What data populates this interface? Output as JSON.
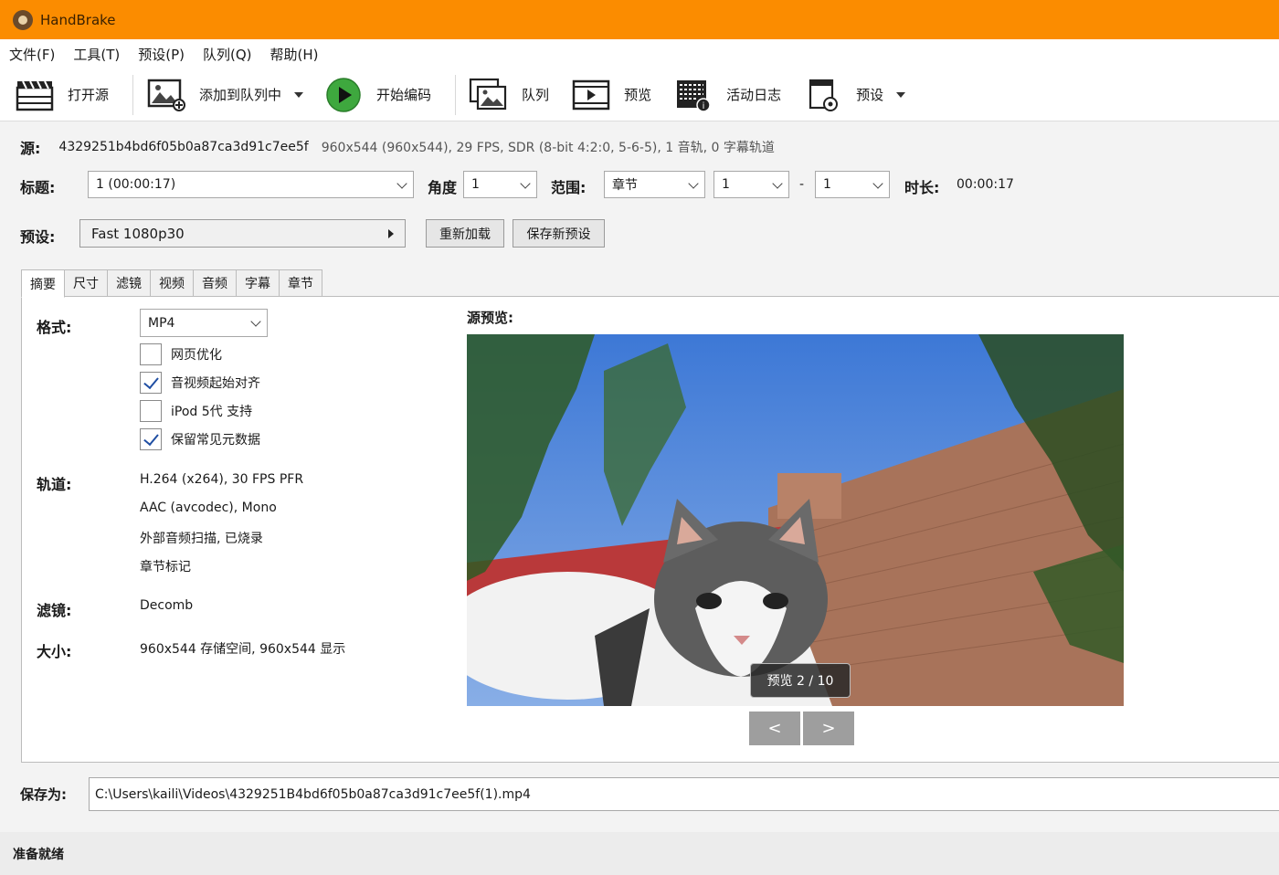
{
  "window": {
    "title": "HandBrake"
  },
  "menu": [
    "文件(F)",
    "工具(T)",
    "预设(P)",
    "队列(Q)",
    "帮助(H)"
  ],
  "toolbar": {
    "open_source": "打开源",
    "add_to_queue": "添加到队列中",
    "start_encode": "开始编码",
    "queue": "队列",
    "preview": "预览",
    "activity_log": "活动日志",
    "presets": "预设"
  },
  "source": {
    "label": "源:",
    "name": "4329251b4bd6f05b0a87ca3d91c7ee5f",
    "info": "960x544 (960x544), 29 FPS, SDR (8-bit 4:2:0, 5-6-5), 1 音轨, 0 字幕轨道"
  },
  "title_row": {
    "title_label": "标题:",
    "title_value": "1 (00:00:17)",
    "angle_label": "角度",
    "angle_value": "1",
    "range_label": "范围:",
    "range_type": "章节",
    "range_start": "1",
    "range_sep": "-",
    "range_end": "1",
    "duration_label": "时长:",
    "duration_value": "00:00:17"
  },
  "preset": {
    "label": "预设:",
    "value": "Fast 1080p30",
    "reload_button": "重新加载",
    "save_new_button": "保存新预设"
  },
  "tabs": [
    "摘要",
    "尺寸",
    "滤镜",
    "视频",
    "音频",
    "字幕",
    "章节"
  ],
  "summary": {
    "format_label": "格式:",
    "format_value": "MP4",
    "options": [
      {
        "label": "网页优化",
        "checked": false
      },
      {
        "label": "音视频起始对齐",
        "checked": true
      },
      {
        "label": "iPod 5代 支持",
        "checked": false
      },
      {
        "label": "保留常见元数据",
        "checked": true
      }
    ],
    "tracks_label": "轨道:",
    "tracks": [
      "H.264 (x264), 30 FPS PFR",
      "AAC (avcodec), Mono",
      "外部音频扫描, 已烧录",
      "章节标记"
    ],
    "filters_label": "滤镜:",
    "filters_value": "Decomb",
    "size_label": "大小:",
    "size_value": "960x544 存储空间, 960x544 显示"
  },
  "preview": {
    "title": "源预览:",
    "badge": "预览 2 / 10",
    "prev": "<",
    "next": ">"
  },
  "save": {
    "label": "保存为:",
    "path": "C:\\Users\\kaili\\Videos\\4329251B4bd6f05b0a87ca3d91c7ee5f(1).mp4"
  },
  "status": "准备就绪"
}
